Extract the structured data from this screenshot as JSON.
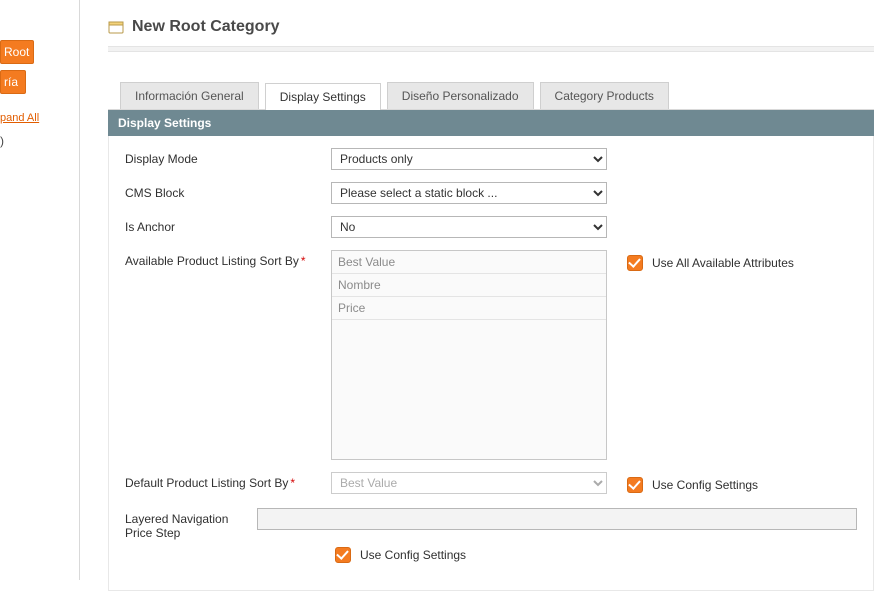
{
  "sidebar": {
    "btn_root": "Root",
    "btn_ria": "ría",
    "expand_all": "pand All",
    "paren": ")"
  },
  "header": {
    "title": "New Root Category"
  },
  "tabs": {
    "general": "Información General",
    "display": "Display Settings",
    "design": "Diseño Personalizado",
    "products": "Category Products"
  },
  "section": {
    "title": "Display Settings"
  },
  "fields": {
    "display_mode": {
      "label": "Display Mode",
      "value": "Products only"
    },
    "cms_block": {
      "label": "CMS Block",
      "value": "Please select a static block ..."
    },
    "is_anchor": {
      "label": "Is Anchor",
      "value": "No"
    },
    "avail_sort": {
      "label": "Available Product Listing Sort By",
      "options": [
        "Best Value",
        "Nombre",
        "Price"
      ],
      "side_label": "Use All Available Attributes"
    },
    "default_sort": {
      "label": "Default Product Listing Sort By",
      "value": "Best Value",
      "side_label": "Use Config Settings"
    },
    "price_step": {
      "label": "Layered Navigation Price Step",
      "value": "",
      "below_label": "Use Config Settings"
    }
  }
}
